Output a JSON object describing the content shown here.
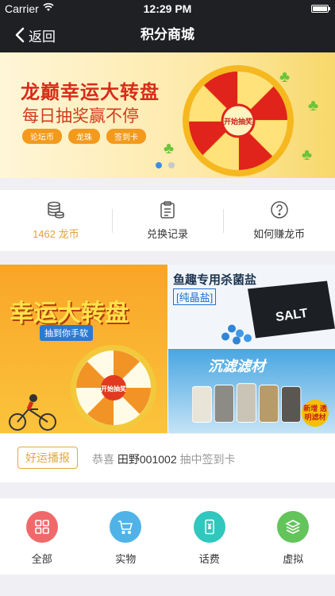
{
  "status_bar": {
    "carrier": "Carrier",
    "time": "12:29 PM"
  },
  "nav": {
    "back_label": "返回",
    "title": "积分商城"
  },
  "banner": {
    "title": "龙巅幸运大转盘",
    "subtitle": "每日抽奖赢不停",
    "tags": [
      "论坛币",
      "龙珠",
      "签到卡"
    ],
    "wheel_center": "开始抽奖",
    "slide_count": 2,
    "active_slide": 1
  },
  "quick_actions": [
    {
      "label": "1462 龙币",
      "icon": "coins-icon"
    },
    {
      "label": "兑换记录",
      "icon": "clipboard-icon"
    },
    {
      "label": "如何赚龙币",
      "icon": "question-icon"
    }
  ],
  "promos": {
    "lucky_wheel": {
      "title": "幸运大转盘",
      "subtitle": "抽到你手软",
      "center": "开始抽奖"
    },
    "salt": {
      "title": "鱼趣专用杀菌盐",
      "tag": "[纯晶盐]"
    },
    "filter": {
      "title": "沉滤滤材",
      "badge": "新增 透明滤材"
    }
  },
  "news": {
    "badge": "好运播报",
    "prefix": "恭喜",
    "user": "田野001002",
    "suffix": "抽中签到卡"
  },
  "categories": [
    {
      "label": "全部",
      "icon": "grid-icon",
      "color": "#f0696a"
    },
    {
      "label": "实物",
      "icon": "cart-icon",
      "color": "#4fb3e8"
    },
    {
      "label": "话费",
      "icon": "phone-icon",
      "color": "#2fc7be"
    },
    {
      "label": "虚拟",
      "icon": "layers-icon",
      "color": "#62c45a"
    }
  ]
}
